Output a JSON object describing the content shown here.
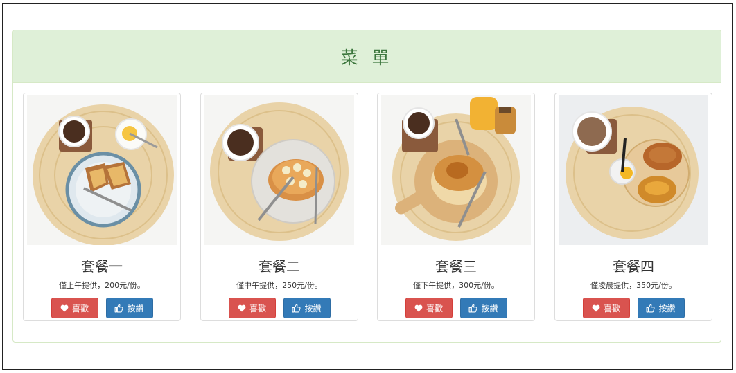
{
  "panel": {
    "title": "菜 單"
  },
  "cards": [
    {
      "title": "套餐一",
      "description": "僅上午提供，200元/份。",
      "like_label": "喜歡",
      "thumb_label": "按讚",
      "image": "toast-breakfast-photo"
    },
    {
      "title": "套餐二",
      "description": "僅中午提供，250元/份。",
      "like_label": "喜歡",
      "thumb_label": "按讚",
      "image": "banana-pancake-photo"
    },
    {
      "title": "套餐三",
      "description": "僅下午提供，300元/份。",
      "like_label": "喜歡",
      "thumb_label": "按讚",
      "image": "pancake-honey-photo"
    },
    {
      "title": "套餐四",
      "description": "僅凌晨提供，350元/份。",
      "like_label": "喜歡",
      "thumb_label": "按讚",
      "image": "croissant-egg-photo"
    }
  ],
  "colors": {
    "heading_bg": "#dff0d8",
    "heading_text": "#3c763d",
    "like_button": "#d9534f",
    "thumb_button": "#337ab7"
  },
  "icons": {
    "like": "heart-icon",
    "thumb": "thumbs-up-icon"
  }
}
